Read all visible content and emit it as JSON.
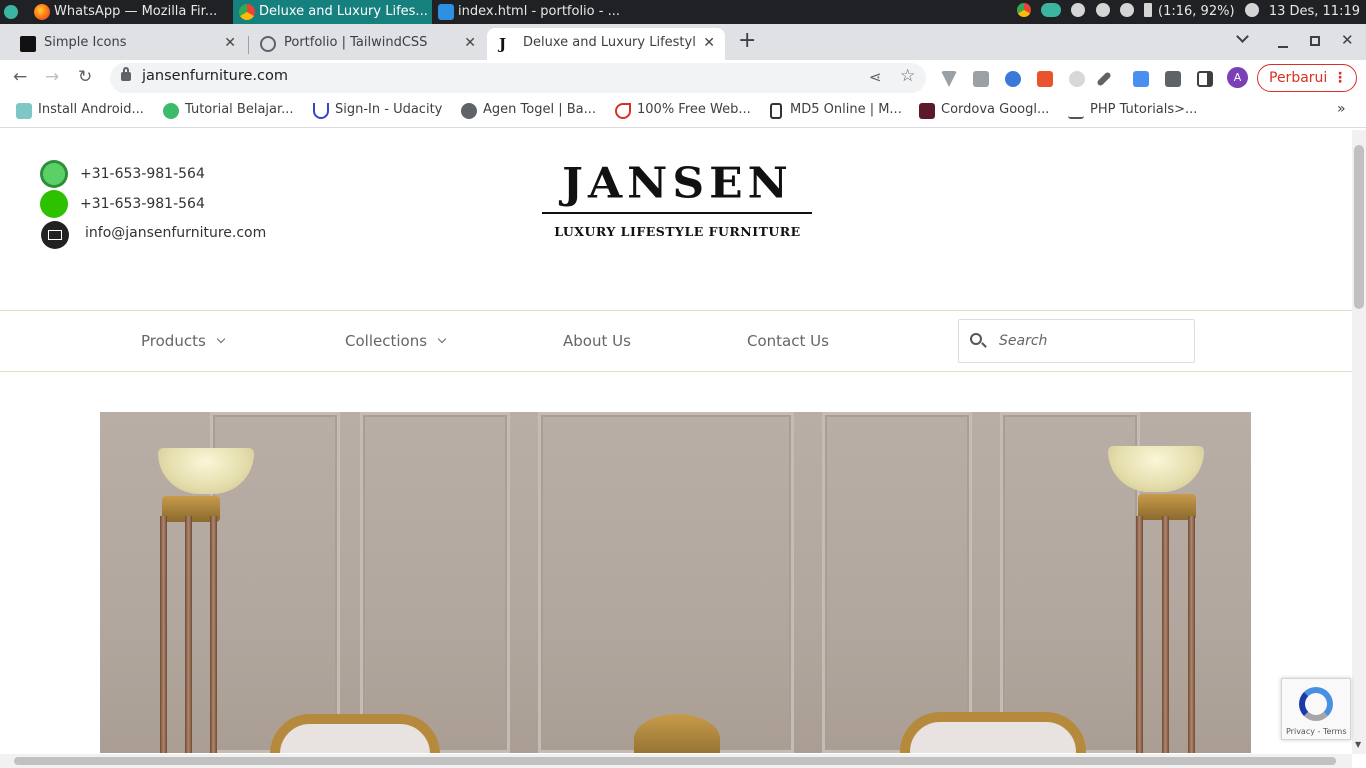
{
  "taskbar": {
    "tasks": [
      {
        "label": "WhatsApp — Mozilla Fir..."
      },
      {
        "label": "Deluxe and Luxury Lifes..."
      },
      {
        "label": "index.html - portfolio - ..."
      }
    ],
    "battery": "(1:16, 92%)",
    "clock": "13 Des, 11:19"
  },
  "browser": {
    "tabs": [
      {
        "label": "Simple Icons"
      },
      {
        "label": "Portfolio | TailwindCSS"
      },
      {
        "label": "Deluxe and Luxury Lifestyl"
      }
    ],
    "url": "jansenfurniture.com",
    "avatar_letter": "A",
    "update_label": "Perbarui",
    "bookmarks": [
      {
        "label": "Install Android..."
      },
      {
        "label": "Tutorial Belajar..."
      },
      {
        "label": "Sign-In - Udacity"
      },
      {
        "label": "Agen Togel | Ba..."
      },
      {
        "label": "100% Free Web..."
      },
      {
        "label": "MD5 Online | M..."
      },
      {
        "label": "Cordova Googl..."
      },
      {
        "label": "PHP Tutorials>..."
      }
    ]
  },
  "page": {
    "contacts": {
      "whatsapp": "+31-653-981-564",
      "wechat": "+31-653-981-564",
      "email": "info@jansenfurniture.com"
    },
    "logo": {
      "main": "JANSEN",
      "sub": "LUXURY LIFESTYLE FURNITURE"
    },
    "menu": [
      {
        "label": "Products"
      },
      {
        "label": "Collections"
      },
      {
        "label": "About Us"
      },
      {
        "label": "Contact Us"
      }
    ],
    "search_placeholder": "Search",
    "recaptcha_text": "Privacy - Terms"
  },
  "colors": {
    "accent_line": "#e7dcc6",
    "update_red": "#d93025",
    "taskbar_active": "#16807f"
  }
}
